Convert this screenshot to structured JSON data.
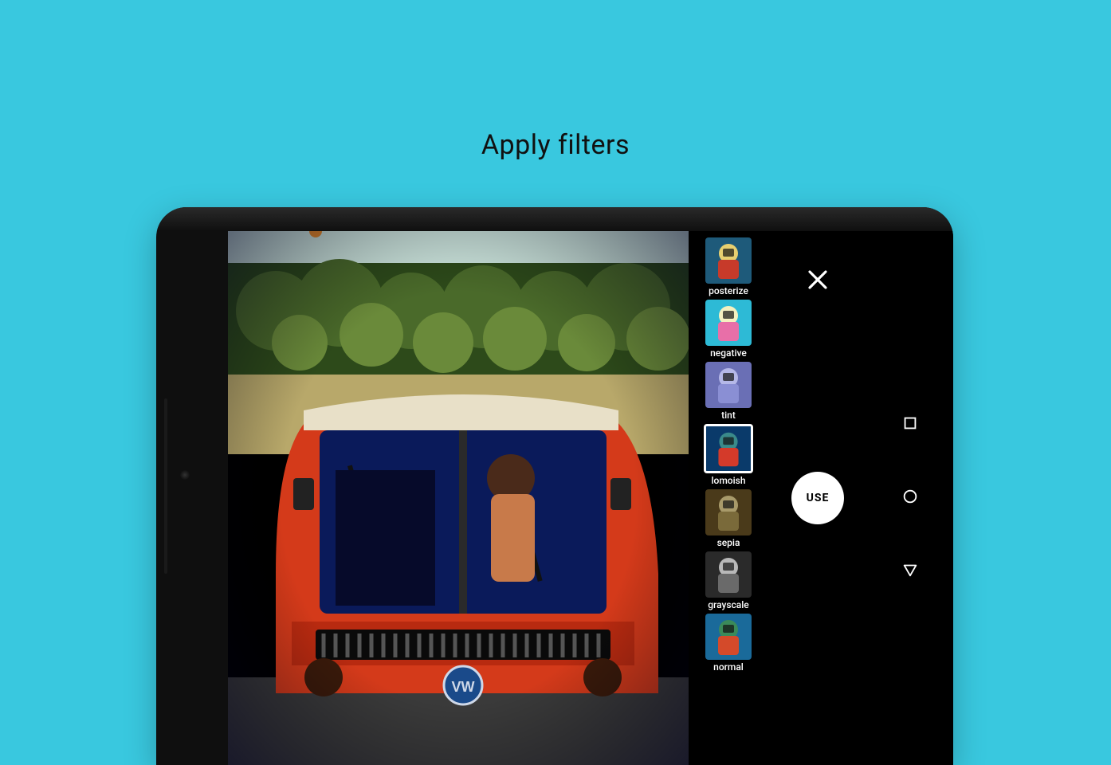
{
  "headline": "Apply filters",
  "editor": {
    "use_button_label": "USE",
    "filters": [
      {
        "label": "posterize",
        "selected": false,
        "colors": [
          "#1e5a7a",
          "#c73a2a",
          "#e8d070"
        ]
      },
      {
        "label": "negative",
        "selected": false,
        "colors": [
          "#2dbad6",
          "#e86fa8",
          "#f5f1c0"
        ]
      },
      {
        "label": "tint",
        "selected": false,
        "colors": [
          "#6a6fb5",
          "#8a8fd4",
          "#b5b8e8"
        ]
      },
      {
        "label": "lomoish",
        "selected": true,
        "colors": [
          "#0a3a6a",
          "#d43a2a",
          "#3a8a8a"
        ]
      },
      {
        "label": "sepia",
        "selected": false,
        "colors": [
          "#4a3a1a",
          "#7a6a3a",
          "#a89a6a"
        ]
      },
      {
        "label": "grayscale",
        "selected": false,
        "colors": [
          "#2a2a2a",
          "#6a6a6a",
          "#b8b8b8"
        ]
      },
      {
        "label": "normal",
        "selected": false,
        "colors": [
          "#1a6a9a",
          "#d44a2a",
          "#3a8a5a"
        ]
      }
    ]
  }
}
